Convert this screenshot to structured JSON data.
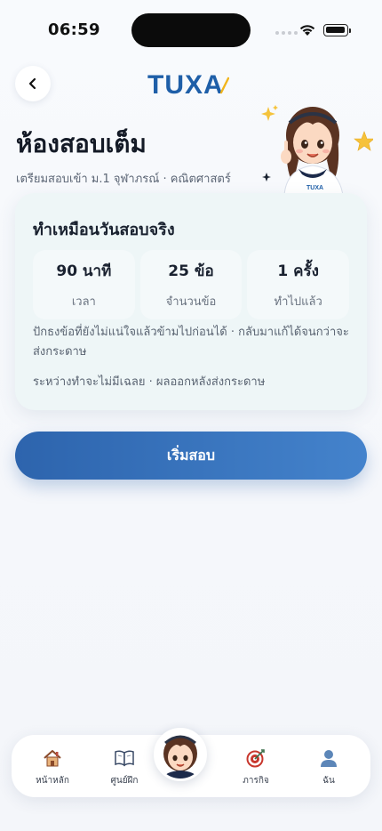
{
  "status_bar": {
    "time": "06:59"
  },
  "header": {
    "logo_text": "TUXA"
  },
  "page": {
    "title": "ห้องสอบเต็ม",
    "subtitle": "เตรียมสอบเข้า ม.1 จุฬาภรณ์ · คณิตศาสตร์"
  },
  "mascot": {
    "shirt_text": "TUXA"
  },
  "card": {
    "title": "ทำเหมือนวันสอบจริง",
    "stats": [
      {
        "value": "90 นาที",
        "label": "เวลา"
      },
      {
        "value": "25 ข้อ",
        "label": "จำนวนข้อ"
      },
      {
        "value": "1 ครั้ง",
        "label": "ทำไปแล้ว"
      }
    ],
    "note_1": "ปักธงข้อที่ยังไม่แน่ใจแล้วข้ามไปก่อนได้ · กลับมาแก้ได้จนกว่าจะส่งกระดาษ",
    "note_2": "ระหว่างทำจะไม่มีเฉลย · ผลออกหลังส่งกระดาษ"
  },
  "start_button": {
    "label": "เริ่มสอบ"
  },
  "nav": {
    "items": [
      {
        "label": "หน้าหลัก",
        "icon": "home-icon"
      },
      {
        "label": "ศูนย์ฝึก",
        "icon": "book-icon"
      },
      {
        "label": "ภารกิจ",
        "icon": "target-icon"
      },
      {
        "label": "ฉัน",
        "icon": "profile-icon"
      }
    ]
  },
  "colors": {
    "accent": "#2d64ad",
    "accent_light": "#4483cc",
    "card_bg": "#eef6f7"
  }
}
